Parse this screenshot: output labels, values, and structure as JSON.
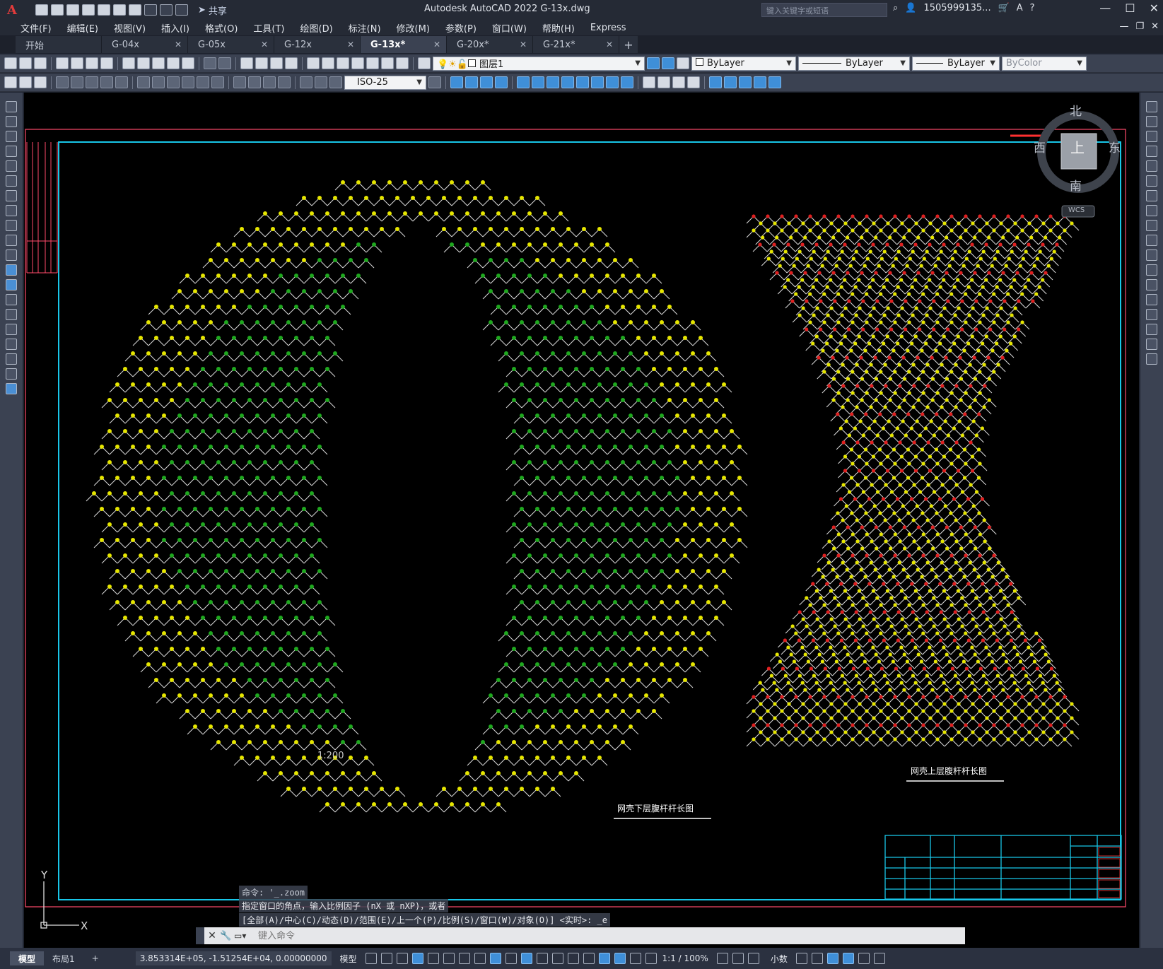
{
  "app": {
    "logo": "A",
    "window_title": "Autodesk AutoCAD 2022    G-13x.dwg",
    "share_label": "共享",
    "search_placeholder": "键入关键字或短语",
    "user_name": "1505999135...",
    "colors": {
      "accent": "#3f8fd8",
      "logo": "#e23b3b",
      "frame": "#00c8ff",
      "border": "#ff4a6a"
    }
  },
  "menu": [
    "文件(F)",
    "编辑(E)",
    "视图(V)",
    "插入(I)",
    "格式(O)",
    "工具(T)",
    "绘图(D)",
    "标注(N)",
    "修改(M)",
    "参数(P)",
    "窗口(W)",
    "帮助(H)",
    "Express"
  ],
  "tabs": [
    {
      "label": "开始",
      "active": false,
      "closable": false
    },
    {
      "label": "G-04x",
      "active": false,
      "closable": true
    },
    {
      "label": "G-05x",
      "active": false,
      "closable": true
    },
    {
      "label": "G-12x",
      "active": false,
      "closable": true
    },
    {
      "label": "G-13x*",
      "active": true,
      "closable": true
    },
    {
      "label": "G-20x*",
      "active": false,
      "closable": true
    },
    {
      "label": "G-21x*",
      "active": false,
      "closable": true
    }
  ],
  "toolbar": {
    "layer": "图层1",
    "color": "ByLayer",
    "linetype": "ByLayer",
    "lineweight": "ByLayer",
    "plotstyle": "ByColor",
    "dimstyle": "ISO-25"
  },
  "viewcube": {
    "north": "北",
    "south": "南",
    "east": "东",
    "west": "西",
    "top": "上",
    "wcs": "WCS"
  },
  "drawing": {
    "left_caption": "网壳下层腹杆杆长图",
    "right_caption": "网壳上层腹杆杆长图",
    "scale_note": "1:200",
    "ucs_y": "Y",
    "ucs_x": "X"
  },
  "command": {
    "history": [
      "命令: '_.zoom",
      "指定窗口的角点，输入比例因子 (nX 或 nXP)，或者",
      "[全部(A)/中心(C)/动态(D)/范围(E)/上一个(P)/比例(S)/窗口(W)/对象(O)] <实时>: _e"
    ],
    "placeholder": "键入命令"
  },
  "status": {
    "layouts": [
      {
        "label": "模型",
        "active": true
      },
      {
        "label": "布局1",
        "active": false
      }
    ],
    "add": "+",
    "coordinates": "3.853314E+05, -1.51254E+04, 0.00000000",
    "space": "模型",
    "annotation_scale": "1:1 / 100%",
    "units": "小数"
  }
}
